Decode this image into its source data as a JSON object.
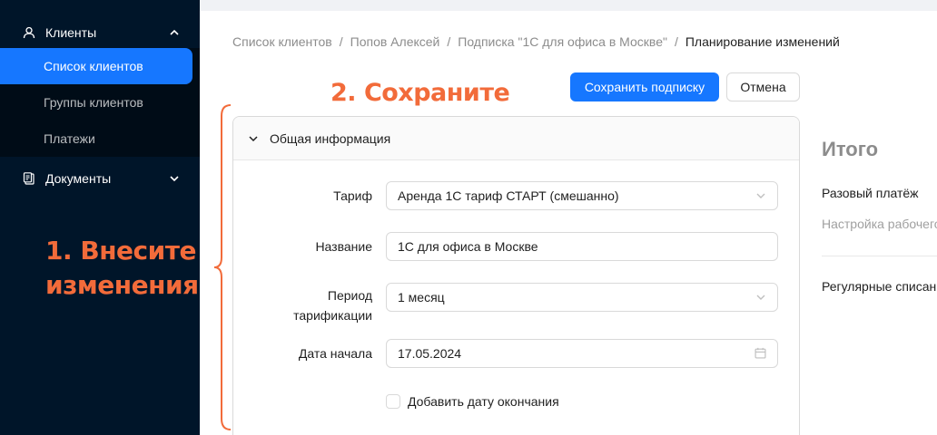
{
  "sidebar": {
    "clients_section": {
      "label": "Клиенты",
      "icon": "user-icon"
    },
    "items": [
      {
        "label": "Список клиентов",
        "active": true
      },
      {
        "label": "Группы клиентов",
        "active": false
      },
      {
        "label": "Платежи",
        "active": false
      }
    ],
    "documents_section": {
      "label": "Документы",
      "icon": "document-icon"
    }
  },
  "annotations": {
    "step1_line1": "1. Внесите",
    "step1_line2": "изменения",
    "step2": "2. Сохраните",
    "color": "#f26b3a"
  },
  "breadcrumb": {
    "items": [
      "Список клиентов",
      "Попов Алексей",
      "Подписка \"1С для офиса в Москве\"",
      "Планирование изменений"
    ],
    "separator": "/"
  },
  "actions": {
    "save_label": "Сохранить подписку",
    "cancel_label": "Отмена"
  },
  "card": {
    "title": "Общая информация"
  },
  "form": {
    "tariff": {
      "label": "Тариф",
      "value": "Аренда 1С тариф СТАРТ (смешанно)"
    },
    "name": {
      "label": "Название",
      "value": "1С для офиса в Москве"
    },
    "period": {
      "label": "Период тарификации",
      "value": "1 месяц"
    },
    "start_date": {
      "label": "Дата начала",
      "value": "17.05.2024"
    },
    "end_date_checkbox": {
      "label": "Добавить дату окончания",
      "checked": false
    }
  },
  "summary": {
    "title": "Итого",
    "one_time": "Разовый платёж",
    "one_time_item": "Настройка рабочего",
    "recurring": "Регулярные списани"
  },
  "colors": {
    "sidebar_bg": "#001529",
    "primary": "#1677ff",
    "annotation": "#f26b3a"
  }
}
